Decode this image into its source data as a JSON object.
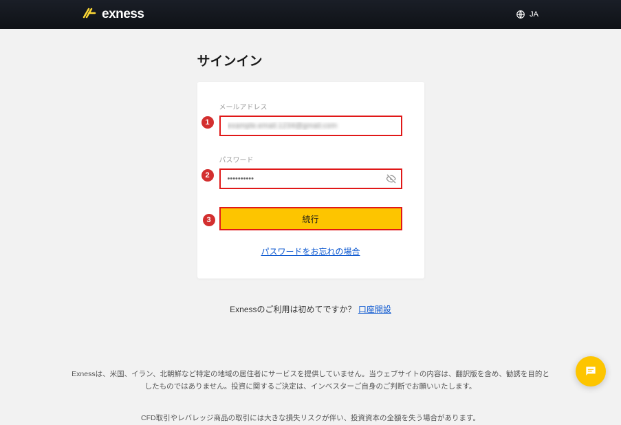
{
  "header": {
    "brand": "exness",
    "language": "JA"
  },
  "page": {
    "title": "サインイン"
  },
  "form": {
    "email": {
      "label": "メールアドレス",
      "value": "example.email.1234@gmail.com"
    },
    "password": {
      "label": "パスワード",
      "value": "••••••••••"
    },
    "submit_label": "続行",
    "forgot_label": "パスワードをお忘れの場合"
  },
  "steps": {
    "one": "1",
    "two": "2",
    "three": "3"
  },
  "signup": {
    "prompt": "Exnessのご利用は初めてですか？ ",
    "link": "口座開設"
  },
  "disclaimers": {
    "line1": "Exnessは、米国、イラン、北朝鮮など特定の地域の居住者にサービスを提供していません。当ウェブサイトの内容は、翻訳版を含め、勧誘を目的としたものではありません。投資に関するご決定は、インベスターご自身のご判断でお願いいたします。",
    "line2": "CFD取引やレバレッジ商品の取引には大きな損失リスクが伴い、投資資本の全額を失う場合があります。"
  }
}
